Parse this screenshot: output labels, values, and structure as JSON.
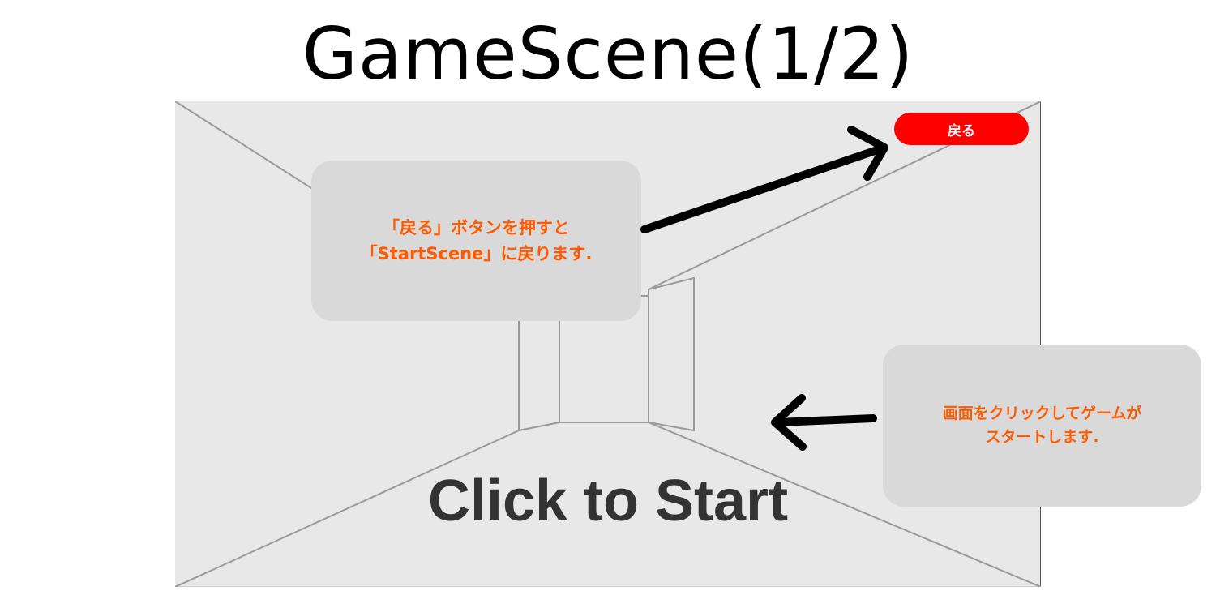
{
  "title": "GameScene(1/2)",
  "game_screen": {
    "start_prompt": "Click to Start",
    "back_button_label": "戻る"
  },
  "annotations": {
    "back_note": {
      "line1": "「戻る」ボタンを押すと",
      "line2": "「StartScene」に戻ります."
    },
    "start_note": {
      "line1": "画面をクリックしてゲームが",
      "line2": "スタートします."
    }
  },
  "colors": {
    "back_button": "#ff0000",
    "annotation_text": "#ff5a00",
    "annotation_box": "#d9d9d9",
    "screen_background": "#e8e8e8"
  },
  "icons": {
    "arrow_to_back_button": "arrow-icon",
    "arrow_to_screen": "arrow-icon"
  }
}
